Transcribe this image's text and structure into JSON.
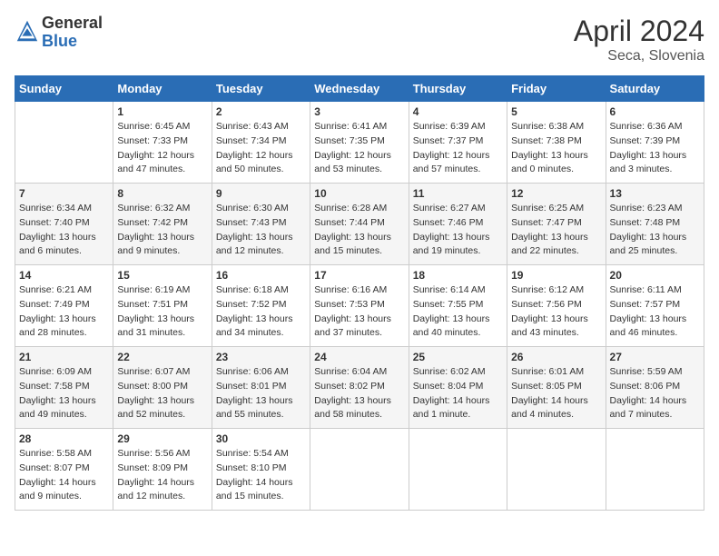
{
  "logo": {
    "general": "General",
    "blue": "Blue"
  },
  "title": {
    "month": "April 2024",
    "location": "Seca, Slovenia"
  },
  "headers": [
    "Sunday",
    "Monday",
    "Tuesday",
    "Wednesday",
    "Thursday",
    "Friday",
    "Saturday"
  ],
  "weeks": [
    [
      {
        "day": null,
        "text": null
      },
      {
        "day": "1",
        "text": "Sunrise: 6:45 AM\nSunset: 7:33 PM\nDaylight: 12 hours\nand 47 minutes."
      },
      {
        "day": "2",
        "text": "Sunrise: 6:43 AM\nSunset: 7:34 PM\nDaylight: 12 hours\nand 50 minutes."
      },
      {
        "day": "3",
        "text": "Sunrise: 6:41 AM\nSunset: 7:35 PM\nDaylight: 12 hours\nand 53 minutes."
      },
      {
        "day": "4",
        "text": "Sunrise: 6:39 AM\nSunset: 7:37 PM\nDaylight: 12 hours\nand 57 minutes."
      },
      {
        "day": "5",
        "text": "Sunrise: 6:38 AM\nSunset: 7:38 PM\nDaylight: 13 hours\nand 0 minutes."
      },
      {
        "day": "6",
        "text": "Sunrise: 6:36 AM\nSunset: 7:39 PM\nDaylight: 13 hours\nand 3 minutes."
      }
    ],
    [
      {
        "day": "7",
        "text": "Sunrise: 6:34 AM\nSunset: 7:40 PM\nDaylight: 13 hours\nand 6 minutes."
      },
      {
        "day": "8",
        "text": "Sunrise: 6:32 AM\nSunset: 7:42 PM\nDaylight: 13 hours\nand 9 minutes."
      },
      {
        "day": "9",
        "text": "Sunrise: 6:30 AM\nSunset: 7:43 PM\nDaylight: 13 hours\nand 12 minutes."
      },
      {
        "day": "10",
        "text": "Sunrise: 6:28 AM\nSunset: 7:44 PM\nDaylight: 13 hours\nand 15 minutes."
      },
      {
        "day": "11",
        "text": "Sunrise: 6:27 AM\nSunset: 7:46 PM\nDaylight: 13 hours\nand 19 minutes."
      },
      {
        "day": "12",
        "text": "Sunrise: 6:25 AM\nSunset: 7:47 PM\nDaylight: 13 hours\nand 22 minutes."
      },
      {
        "day": "13",
        "text": "Sunrise: 6:23 AM\nSunset: 7:48 PM\nDaylight: 13 hours\nand 25 minutes."
      }
    ],
    [
      {
        "day": "14",
        "text": "Sunrise: 6:21 AM\nSunset: 7:49 PM\nDaylight: 13 hours\nand 28 minutes."
      },
      {
        "day": "15",
        "text": "Sunrise: 6:19 AM\nSunset: 7:51 PM\nDaylight: 13 hours\nand 31 minutes."
      },
      {
        "day": "16",
        "text": "Sunrise: 6:18 AM\nSunset: 7:52 PM\nDaylight: 13 hours\nand 34 minutes."
      },
      {
        "day": "17",
        "text": "Sunrise: 6:16 AM\nSunset: 7:53 PM\nDaylight: 13 hours\nand 37 minutes."
      },
      {
        "day": "18",
        "text": "Sunrise: 6:14 AM\nSunset: 7:55 PM\nDaylight: 13 hours\nand 40 minutes."
      },
      {
        "day": "19",
        "text": "Sunrise: 6:12 AM\nSunset: 7:56 PM\nDaylight: 13 hours\nand 43 minutes."
      },
      {
        "day": "20",
        "text": "Sunrise: 6:11 AM\nSunset: 7:57 PM\nDaylight: 13 hours\nand 46 minutes."
      }
    ],
    [
      {
        "day": "21",
        "text": "Sunrise: 6:09 AM\nSunset: 7:58 PM\nDaylight: 13 hours\nand 49 minutes."
      },
      {
        "day": "22",
        "text": "Sunrise: 6:07 AM\nSunset: 8:00 PM\nDaylight: 13 hours\nand 52 minutes."
      },
      {
        "day": "23",
        "text": "Sunrise: 6:06 AM\nSunset: 8:01 PM\nDaylight: 13 hours\nand 55 minutes."
      },
      {
        "day": "24",
        "text": "Sunrise: 6:04 AM\nSunset: 8:02 PM\nDaylight: 13 hours\nand 58 minutes."
      },
      {
        "day": "25",
        "text": "Sunrise: 6:02 AM\nSunset: 8:04 PM\nDaylight: 14 hours\nand 1 minute."
      },
      {
        "day": "26",
        "text": "Sunrise: 6:01 AM\nSunset: 8:05 PM\nDaylight: 14 hours\nand 4 minutes."
      },
      {
        "day": "27",
        "text": "Sunrise: 5:59 AM\nSunset: 8:06 PM\nDaylight: 14 hours\nand 7 minutes."
      }
    ],
    [
      {
        "day": "28",
        "text": "Sunrise: 5:58 AM\nSunset: 8:07 PM\nDaylight: 14 hours\nand 9 minutes."
      },
      {
        "day": "29",
        "text": "Sunrise: 5:56 AM\nSunset: 8:09 PM\nDaylight: 14 hours\nand 12 minutes."
      },
      {
        "day": "30",
        "text": "Sunrise: 5:54 AM\nSunset: 8:10 PM\nDaylight: 14 hours\nand 15 minutes."
      },
      {
        "day": null,
        "text": null
      },
      {
        "day": null,
        "text": null
      },
      {
        "day": null,
        "text": null
      },
      {
        "day": null,
        "text": null
      }
    ]
  ]
}
